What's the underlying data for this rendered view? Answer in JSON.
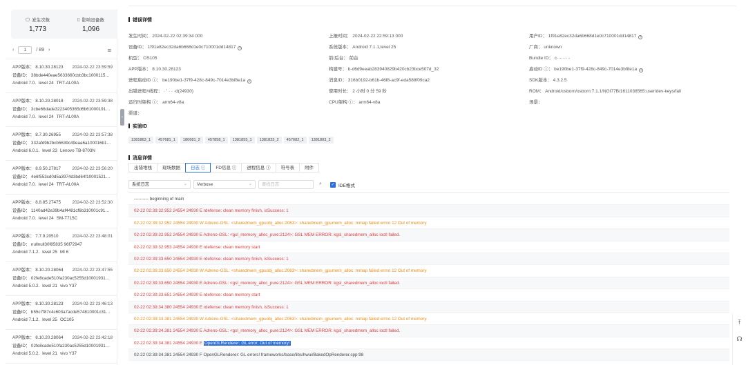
{
  "stats": {
    "occurrences_label": "发生次数",
    "occurrences_value": "1,773",
    "devices_label": "影响设备数",
    "devices_value": "1,096"
  },
  "pager": {
    "current": "1",
    "total": "/ 89",
    "prev": "‹",
    "next": "›"
  },
  "list": [
    {
      "app": "APP版本： 8.10.30.28123",
      "time": "2024-02-22 23:59:59",
      "device_id": "设备ID： 38bde440eae5633660cbb3bc1000115…",
      "os": "Android 7.0.",
      "level": "level 24",
      "model": "TRT-AL00A"
    },
    {
      "app": "APP版本： 8.10.20.28018",
      "time": "2024-02-22 23:59:38",
      "device_id": "设备ID： 3cbe66dade3223405365d6b61000191…",
      "os": "Android 7.0.",
      "level": "level 24",
      "model": "TRT-AL00A"
    },
    {
      "app": "APP版本： 8.7.30.26955",
      "time": "2024-02-22 23:57:38",
      "device_id": "设备ID： 332afd9b2bcb5639c49eaa6a100016b1…",
      "os": "Android 6.0.1.",
      "level": "level 23",
      "model": "Lenovo TB-8703N"
    },
    {
      "app": "APP版本： 8.9.50.27817",
      "time": "2024-02-22 23:56:20",
      "device_id": "设备ID： 4e6f553cd0d5a3974d3bd64f10001521…",
      "os": "Android 7.0.",
      "level": "level 24",
      "model": "TRT-AL00A"
    },
    {
      "app": "APP版本： 8.8.85.27475",
      "time": "2024-02-22 23:52:30",
      "device_id": "设备ID： 1140ad42e39b4af4481cf6b310001c91…",
      "os": "Android 7.0.",
      "level": "level 24",
      "model": "SM-T715C"
    },
    {
      "app": "APP版本： 7.7.9.20510",
      "time": "2024-02-22 23:48:01",
      "device_id": "设备ID： nullnull30f85835 96f72947",
      "os": "Android 7.1.2.",
      "level": "level 25",
      "model": "MI 6"
    },
    {
      "app": "APP版本： 8.10.20.28064",
      "time": "2024-02-22 23:47:55",
      "device_id": "设备ID： 02fe8cade510fa230ac5255d10001931…",
      "os": "Android 5.0.2.",
      "level": "level 21",
      "model": "vivo Y37"
    },
    {
      "app": "APP版本： 8.10.30.28123",
      "time": "2024-02-22 23:46:13",
      "device_id": "设备ID： b55c7f87c4c603a7acde574810001c31…",
      "os": "Android 7.1.2.",
      "level": "level 25",
      "model": "OC105"
    },
    {
      "app": "APP版本： 8.10.20.28064",
      "time": "2024-02-22 23:42:18",
      "device_id": "设备ID： 02fe8cade510fa230ac5255d10001931…",
      "os": "Android 5.0.2.",
      "level": "level 21",
      "model": "vivo Y37"
    }
  ],
  "error_section": {
    "title": "错误详情",
    "col1": {
      "occur_time": "发生时间： 2024-02-22 02:39:34 000",
      "device_id": "设备ID： 1f91e82ec32da6b668d1e0c710001dd14817",
      "model": "机型： OS105",
      "app_version": "APP版本： 8.10.30.28123",
      "process_launch_id": "进程启动ID ⓘ： be190be1-37f9-428c-849c-7014e3bf8e1a",
      "error_thread": "出错进程#线程：  ·   '  ·    ·  ·d(24930)",
      "runtime_arch": "运行时架构 ⓘ： arm64-v8a",
      "channel": "渠道："
    },
    "col2": {
      "report_time": "上报时间： 2024-02-22 22:59:13 000",
      "system_version": "系统版本： Android 7.1.1,level 25",
      "fg_bg": "前/后台： 前台",
      "build_no": "构建号： b-d6d9eeab283940829b420cb23bce507d_32",
      "message_id": "消息ID： 316b0192-b61b-46f8-ac9f-eda588f09ca2",
      "duration": "使用时长： 2 小时 0 分 59 秒",
      "cpu_arch": "CPU架构 ⓘ： arm64-v8a"
    },
    "col3": {
      "user_id": "用户ID： 1f91e82ec32da6b668d1e0c710001dd14817",
      "vendor": "厂商： unknown",
      "bundle_id": "Bundle ID： c·········",
      "launch_id": "启动ID ⓘ： be190be1-37f9-428c-849c-7014e3bf8e1a",
      "sdk_version": "SDK版本： 4.3.2.5",
      "rom": "ROM： Android/osborn/osborn:7.1.1/NGI77B/1611038565:user/dev-keys/fail",
      "scene": "场景："
    }
  },
  "instance_section": {
    "title": "实验ID",
    "tags": [
      "1381863_1",
      "457681_1",
      "180681_2",
      "457858_1",
      "1381855_1",
      "1381825_2",
      "457682_1",
      "1381803_2"
    ]
  },
  "message_section": {
    "title": "消息详情",
    "tabs": [
      "出错堆栈",
      "现场数据",
      "日志 ⓘ",
      "FD信息 ⓘ",
      "进程信息 ⓘ",
      "符号表",
      "附件"
    ],
    "active_tab": 2,
    "log_source": "系统日志",
    "log_level": "Verbose",
    "search_placeholder": "查找日志",
    "ide_label": "IDE格式"
  },
  "log_lines": [
    {
      "text": "---------- beginning of main",
      "kind": "n"
    },
    {
      "text": "02-22 02:39:32.952 24554 24930 E rdefense: clean memory finish, isSuccess: 1",
      "kind": "e"
    },
    {
      "text": "02-22 02:39:32.952 24554 24930 W Adreno-GSL: <sharedmem_gpuobj_alloc:2063>: sharedmem_gpumem_alloc: mmap failed errno 12 Out of memory",
      "kind": "w"
    },
    {
      "text": "02-22 02:39:32.952 24554 24930 E Adreno-GSL: <gsl_memory_alloc_pure:2124>: GSL MEM ERROR: kgsl_sharedmem_alloc ioctl failed.",
      "kind": "e"
    },
    {
      "text": "02-22 02:39:32.953 24554 24930 E rdefense: clean memory start",
      "kind": "e"
    },
    {
      "text": "02-22 02:39:33.650 24554 24930 E rdefense: clean memory finish, isSuccess: 1",
      "kind": "e"
    },
    {
      "text": "02-22 02:39:33.650 24554 24930 W Adreno-GSL: <sharedmem_gpuobj_alloc:2063>: sharedmem_gpumem_alloc: mmap failed errno 12 Out of memory",
      "kind": "w"
    },
    {
      "text": "02-22 02:39:33.650 24554 24930 E Adreno-GSL: <gsl_memory_alloc_pure:2124>: GSL MEM ERROR: kgsl_sharedmem_alloc ioctl failed.",
      "kind": "e"
    },
    {
      "text": "02-22 02:39:33.651 24554 24930 E rdefense: clean memory start",
      "kind": "e"
    },
    {
      "text": "02-22 02:39:34.380 24554 24930 E rdefense: clean memory finish, isSuccess: 1",
      "kind": "e"
    },
    {
      "text": "02-22 02:39:34.381 24554 24930 W Adreno-GSL: <sharedmem_gpuobj_alloc:2063>: sharedmem_gpumem_alloc: mmap failed errno 12 Out of memory",
      "kind": "w"
    },
    {
      "text": "02-22 02:39:34.381 24554 24930 E Adreno-GSL: <gsl_memory_alloc_pure:2124>: GSL MEM ERROR: kgsl_sharedmem_alloc ioctl failed.",
      "kind": "e"
    },
    {
      "text": "02-22 02:39:34.381 24554 24930 E ",
      "highlight": "OpenGLRenderer: GL error: Out of memory!",
      "kind": "e"
    },
    {
      "text": "02-22 02:39:34.381 24554 24930 F OpenGLRenderer: GL errors! frameworks/base/libs/hwui/BakedOpRenderer.cpp:98",
      "kind": "n"
    }
  ],
  "colors": {
    "accent": "#2f6fd8",
    "error": "#e23b3b",
    "warn": "#f08a18"
  }
}
